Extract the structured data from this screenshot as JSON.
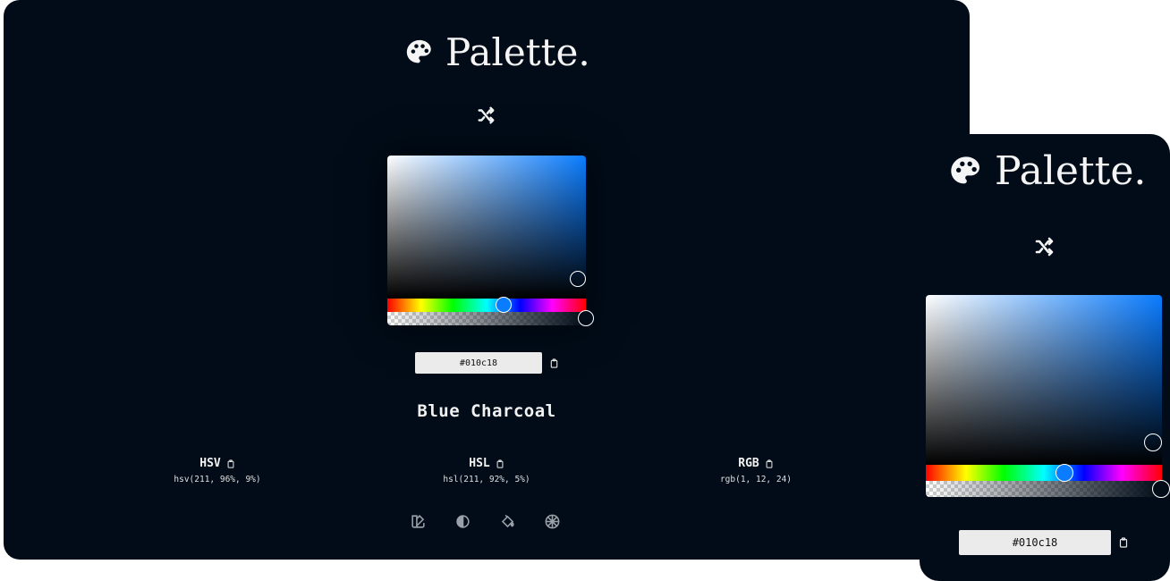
{
  "app": {
    "name": "Palette."
  },
  "desktop": {
    "hex_value": "#010c18",
    "color_name": "Blue Charcoal",
    "formats": [
      {
        "label": "HSV",
        "value": "hsv(211, 96%, 9%)"
      },
      {
        "label": "HSL",
        "value": "hsl(211, 92%, 5%)"
      },
      {
        "label": "RGB",
        "value": "rgb(1, 12, 24)"
      }
    ],
    "tools": [
      "complementary-icon",
      "contrast-icon",
      "fill-icon",
      "color-wheel-icon"
    ]
  },
  "mobile": {
    "hex_value": "#010c18"
  },
  "colors": {
    "background": "#010c18",
    "hue": "#0a7cff",
    "text": "#f2f2f2",
    "input": "#ebebeb"
  },
  "icons": {
    "logo": "palette-icon",
    "shuffle": "shuffle-icon",
    "copy": "clipboard-icon"
  }
}
